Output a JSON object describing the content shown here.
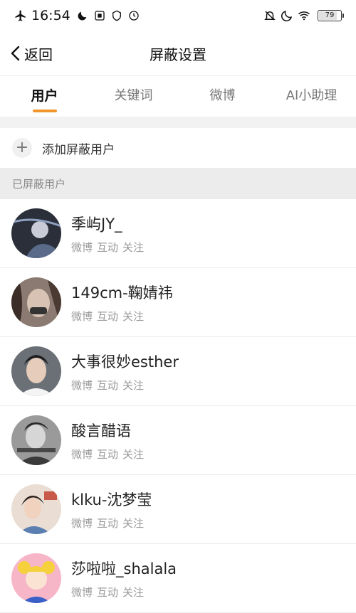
{
  "status_bar": {
    "time": "16:54",
    "battery": "79"
  },
  "nav": {
    "back_label": "返回",
    "title": "屏蔽设置"
  },
  "tabs": [
    {
      "label": "用户"
    },
    {
      "label": "关键词"
    },
    {
      "label": "微博"
    },
    {
      "label": "AI小助理"
    }
  ],
  "add_user": {
    "label": "添加屏蔽用户"
  },
  "section": {
    "title": "已屏蔽用户"
  },
  "users": [
    {
      "name": "季屿JY_",
      "actions": [
        "微博",
        "互动",
        "关注"
      ]
    },
    {
      "name": "149cm-鞠婧祎",
      "actions": [
        "微博",
        "互动",
        "关注"
      ]
    },
    {
      "name": "大事很妙esther",
      "actions": [
        "微博",
        "互动",
        "关注"
      ]
    },
    {
      "name": "酸言醋语",
      "actions": [
        "微博",
        "互动",
        "关注"
      ]
    },
    {
      "name": "klku-沈梦莹",
      "actions": [
        "微博",
        "互动",
        "关注"
      ]
    },
    {
      "name": "莎啦啦_shalala",
      "actions": [
        "微博",
        "互动",
        "关注"
      ]
    }
  ],
  "colors": {
    "accent": "#f0962b",
    "section_bg": "#ececec"
  }
}
